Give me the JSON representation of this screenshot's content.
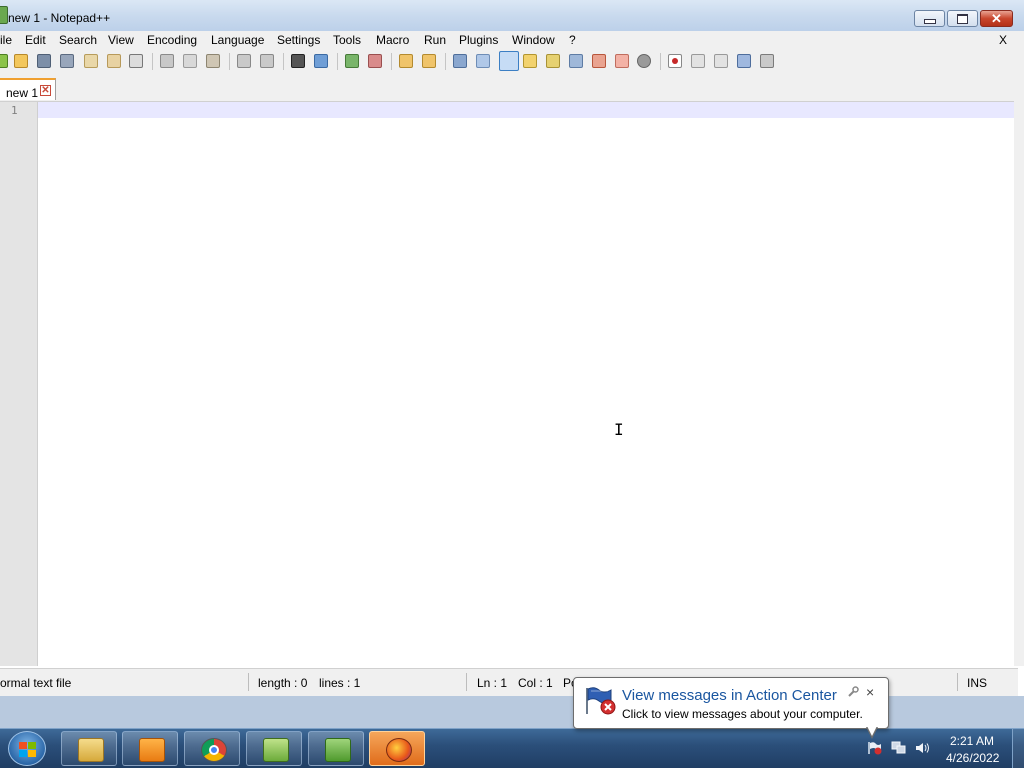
{
  "window": {
    "title": "new 1 - Notepad++",
    "close_glyph": "✕"
  },
  "menu": {
    "items": [
      "ile",
      "Edit",
      "Search",
      "View",
      "Encoding",
      "Language",
      "Settings",
      "Tools",
      "Macro",
      "Run",
      "Plugins",
      "Window",
      "?"
    ],
    "close_x": "X"
  },
  "tabs": [
    {
      "label": "new 1",
      "close_glyph": "✕"
    }
  ],
  "editor": {
    "line_numbers": [
      "1"
    ],
    "content": "",
    "cursor_glyph": "I"
  },
  "status": {
    "file_type": "ormal text file",
    "length": "length : 0",
    "lines": "lines : 1",
    "ln": "Ln : 1",
    "col": "Col : 1",
    "pos_partial": "Po",
    "insert_mode": "INS"
  },
  "taskbar": {
    "apps": [
      "windows-explorer",
      "media-player",
      "chrome",
      "notepad-plus-plus",
      "gvim",
      "firefox"
    ]
  },
  "tray": {
    "time": "2:21 AM",
    "date": "4/26/2022"
  },
  "notification": {
    "title": "View messages in Action Center",
    "body": "Click to view messages about your computer.",
    "close_glyph": "×"
  },
  "colors": {
    "current_line": "#e8e8ff",
    "tab_accent": "#f0a030",
    "notification_title": "#1a56a0",
    "taskbar": "#2b4f7a"
  }
}
